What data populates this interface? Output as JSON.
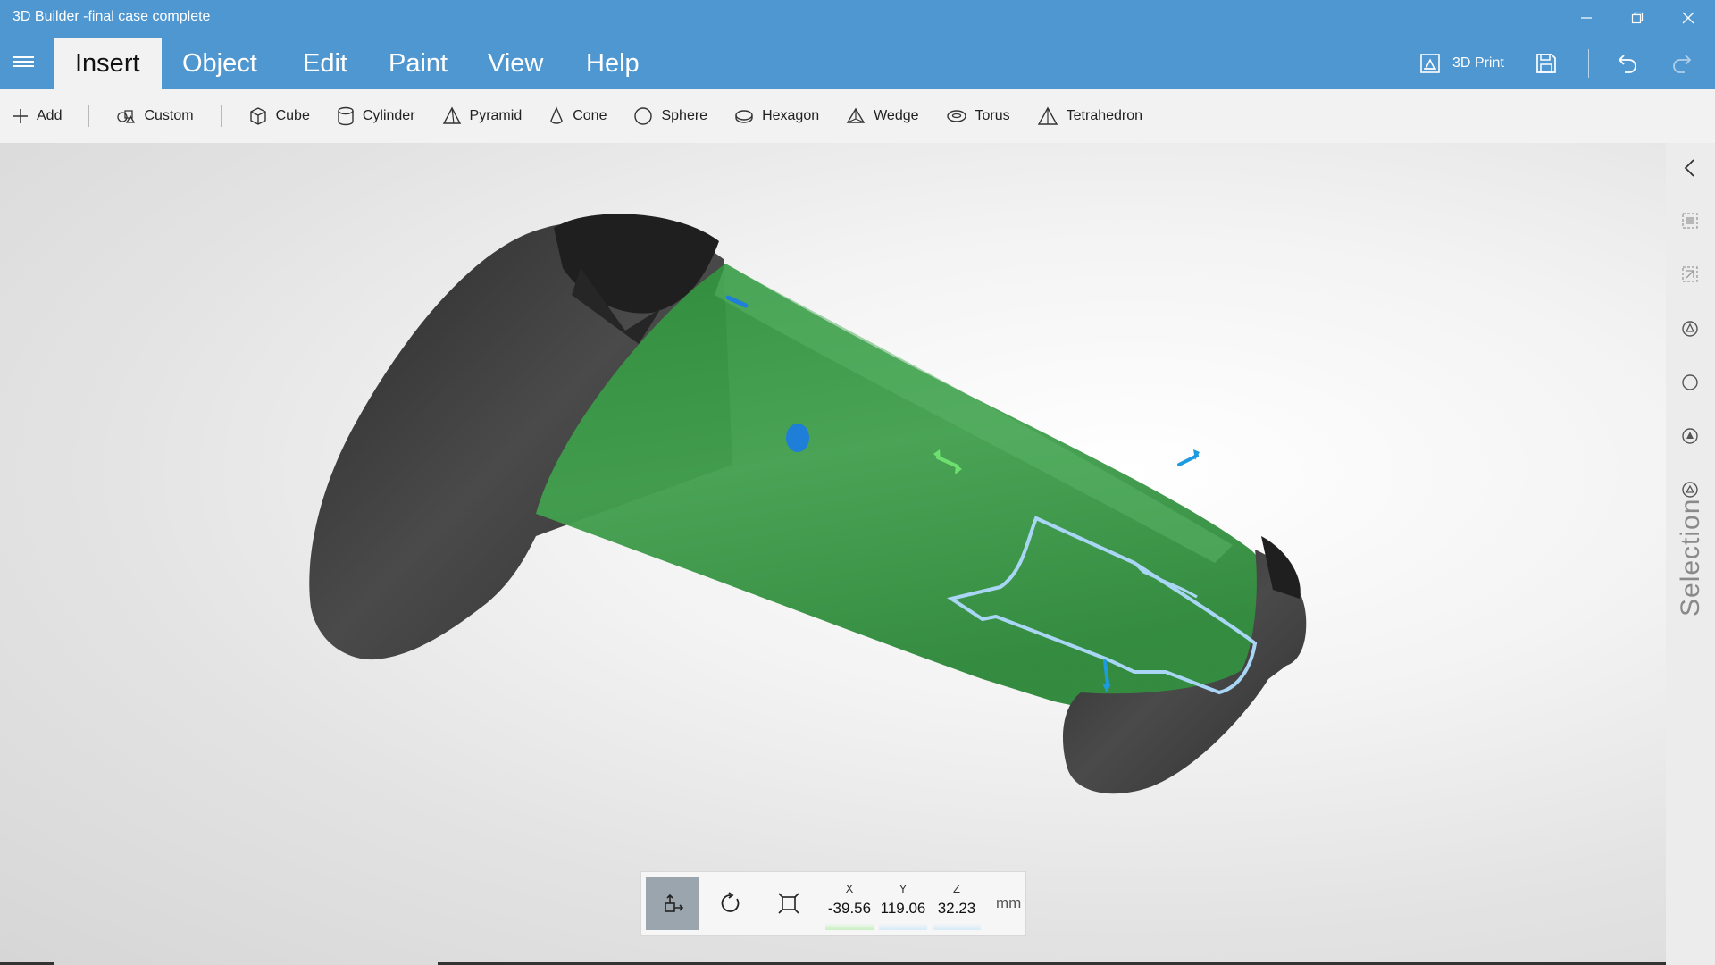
{
  "window": {
    "title": "3D Builder -final case complete"
  },
  "menu": {
    "tabs": [
      {
        "label": "Insert"
      },
      {
        "label": "Object"
      },
      {
        "label": "Edit"
      },
      {
        "label": "Paint"
      },
      {
        "label": "View"
      },
      {
        "label": "Help"
      }
    ],
    "active_tab": "Insert",
    "print_label": "3D Print"
  },
  "toolbar": {
    "add_label": "Add",
    "custom_label": "Custom",
    "shapes": [
      {
        "label": "Cube",
        "icon": "cube-icon"
      },
      {
        "label": "Cylinder",
        "icon": "cylinder-icon"
      },
      {
        "label": "Pyramid",
        "icon": "pyramid-icon"
      },
      {
        "label": "Cone",
        "icon": "cone-icon"
      },
      {
        "label": "Sphere",
        "icon": "sphere-icon"
      },
      {
        "label": "Hexagon",
        "icon": "hexagon-icon"
      },
      {
        "label": "Wedge",
        "icon": "wedge-icon"
      },
      {
        "label": "Torus",
        "icon": "torus-icon"
      },
      {
        "label": "Tetrahedron",
        "icon": "tetrahedron-icon"
      }
    ]
  },
  "side_panel": {
    "label": "Selection"
  },
  "transform": {
    "x_label": "X",
    "x_value": "-39.56",
    "y_label": "Y",
    "y_value": "119.06",
    "z_label": "Z",
    "z_value": "32.23",
    "unit": "mm"
  },
  "colors": {
    "title_bar": "#4f97d1",
    "model_green": "#3a9a45",
    "model_dark": "#3c3c3c",
    "selection_outline": "#a9d6f5"
  }
}
